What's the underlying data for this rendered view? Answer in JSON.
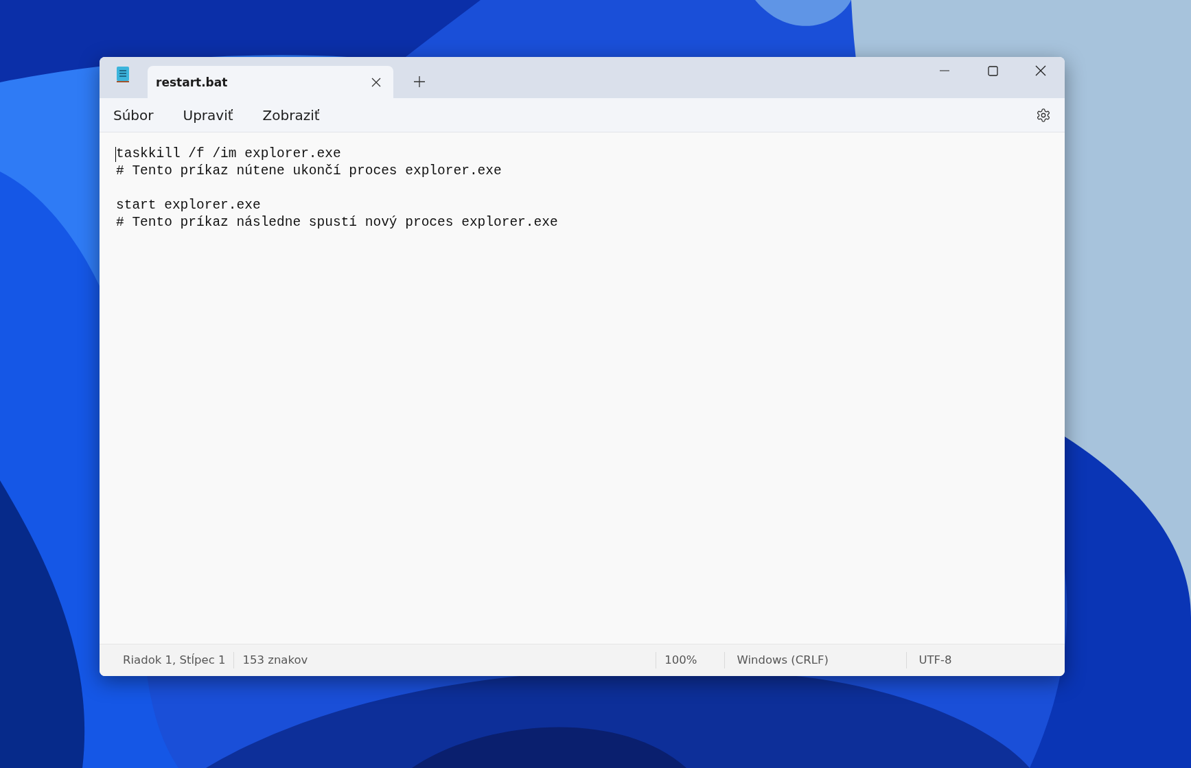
{
  "window": {
    "tabs": [
      {
        "title": "restart.bat",
        "selected": true
      }
    ],
    "menu": [
      "Súbor",
      "Upraviť",
      "Zobraziť"
    ]
  },
  "editor": {
    "blocks": [
      [
        "taskkill /f /im explorer.exe",
        "# Tento príkaz nútene ukončí proces explorer.exe"
      ],
      [
        "start explorer.exe",
        "# Tento príkaz následne spustí nový proces explorer.exe"
      ]
    ]
  },
  "status_bar": {
    "position": "Riadok 1, Stĺpec 1",
    "characters": "153 znakov",
    "zoom": "100%",
    "line_endings": "Windows (CRLF)",
    "encoding": "UTF-8"
  }
}
